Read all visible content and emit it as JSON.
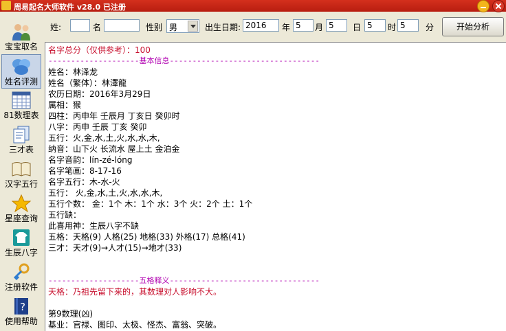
{
  "window": {
    "title": "周易起名大师软件 v28.0  已注册"
  },
  "sidebar": {
    "items": [
      {
        "label": "宝宝取名",
        "icon": "people-icon"
      },
      {
        "label": "姓名评测",
        "icon": "bubbles-icon"
      },
      {
        "label": "81数理表",
        "icon": "table-icon"
      },
      {
        "label": "三才表",
        "icon": "documents-icon"
      },
      {
        "label": "汉字五行",
        "icon": "book-icon"
      },
      {
        "label": "星座查询",
        "icon": "star-icon"
      },
      {
        "label": "生辰八字",
        "icon": "shirt-icon"
      },
      {
        "label": "注册软件",
        "icon": "key-icon"
      },
      {
        "label": "使用帮助",
        "icon": "help-icon"
      }
    ]
  },
  "toolbar": {
    "surname_label": "姓:",
    "surname_value": "",
    "name_label": "名",
    "name_value": "",
    "gender_label": "性别",
    "gender_value": "男",
    "birth_label": "出生日期:",
    "year_value": "2016",
    "year_label": "年",
    "month_value": "5",
    "month_label": "月",
    "day_value": "5",
    "day_label": "日",
    "hour_value": "5",
    "hour_label": "时",
    "minute_value": "5",
    "minute_label": "分",
    "analyze_label": "开始分析"
  },
  "result": {
    "score": "名字总分（仅供参考）：100",
    "basic_header": "--------------------基本信息---------------------------------",
    "name": "姓名：林泽龙",
    "name_trad": "姓名（繁体）：林澤龍",
    "lunar_date": "农历日期：2016年3月29日",
    "zodiac": "属相：猴",
    "sizhu": "四柱：丙申年 壬辰月 丁亥日 癸卯时",
    "bazi": "八字：丙申 壬辰 丁亥 癸卯",
    "wuxing": "五行：火,金,水,土,火,水,水,木,",
    "nayin": "纳音：山下火 长流水 屋上土 金泊金",
    "pinyin": "名字音韵：lín-zé-lóng",
    "strokes": "名字笔画：8-17-16",
    "name_wuxing": "名字五行：木-水-火",
    "wuxing2": "五行： 火,金,水,土,火,水,水,木,",
    "wuxing_count": "五行个数： 金：1个  木：1个  水：3个  火：2个  土：1个",
    "wuxing_lack": "五行缺：",
    "xiyongshen": "此喜用神：生辰八字不缺",
    "wuge": "五格：天格(9) 人格(25) 地格(33) 外格(17) 总格(41)",
    "sancai": "三才：天才(9)→人才(15)→地才(33)",
    "wuge_header": "--------------------五格释义---------------------------------",
    "tiange": "天格：乃祖先留下来的，其数理对人影响不大。",
    "num9": "第9数理(凶)",
    "jiye": "基业：官禄、图印、太极、怪杰、富翁、突破。"
  },
  "colors": {
    "title_red": "#c8102e",
    "header_magenta": "#b000b0",
    "titlebar": "#c8261a"
  }
}
